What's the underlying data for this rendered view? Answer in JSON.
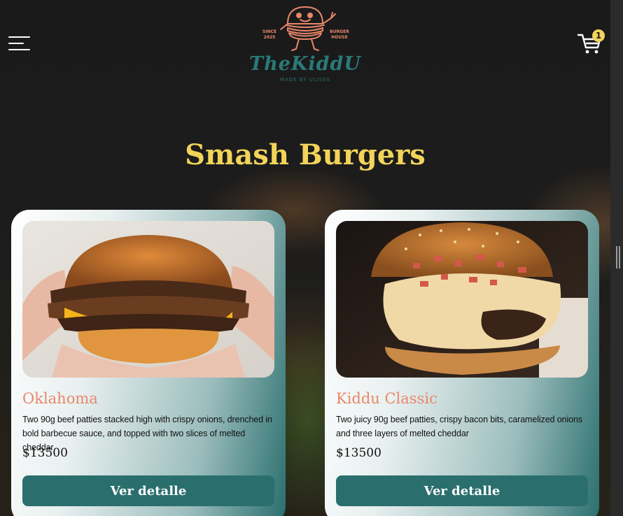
{
  "header": {
    "brand_name": "TheKiddU",
    "brand_sub": "MADE BY ULISES",
    "since": "SINCE 2025",
    "burger_house": "BURGER HOUSE",
    "cart_count": "1"
  },
  "section": {
    "title": "Smash Burgers"
  },
  "products": [
    {
      "name": "Oklahoma",
      "description": "Two 90g beef patties stacked high with crispy onions, drenched in bold barbecue sauce, and topped with two slices of melted cheddar",
      "price": "$13500",
      "button_label": "Ver detalle"
    },
    {
      "name": "Kiddu Classic",
      "description": "Two juicy 90g beef patties, crispy bacon bits, caramelized onions and three layers of melted cheddar",
      "price": "$13500",
      "button_label": "Ver detalle"
    }
  ],
  "colors": {
    "accent_teal": "#2a6f6e",
    "title_yellow": "#f2d45a",
    "product_name_orange": "#e9876a"
  },
  "icons": [
    "hamburger-menu-icon",
    "burger-mascot-logo",
    "cart-icon"
  ]
}
